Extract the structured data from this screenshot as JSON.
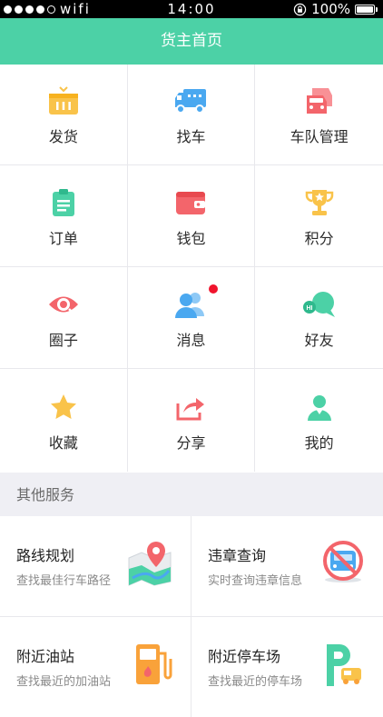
{
  "status_bar": {
    "carrier": "wifi",
    "time": "14:00",
    "battery": "100%"
  },
  "header": {
    "title": "货主首页"
  },
  "grid": {
    "rows": [
      [
        {
          "label": "发货",
          "icon": "cargo-box-icon",
          "color": "#f9c34a"
        },
        {
          "label": "找车",
          "icon": "truck-icon",
          "color": "#4aa8f0"
        },
        {
          "label": "车队管理",
          "icon": "fleet-cars-icon",
          "color": "#f3656b"
        }
      ],
      [
        {
          "label": "订单",
          "icon": "clipboard-icon",
          "color": "#4cd1a6"
        },
        {
          "label": "钱包",
          "icon": "wallet-icon",
          "color": "#f3656b"
        },
        {
          "label": "积分",
          "icon": "trophy-icon",
          "color": "#f9c34a"
        }
      ],
      [
        {
          "label": "圈子",
          "icon": "eye-circle-icon",
          "color": "#f3656b"
        },
        {
          "label": "消息",
          "icon": "users-icon",
          "color": "#4aa8f0",
          "badge": true
        },
        {
          "label": "好友",
          "icon": "chat-bubble-icon",
          "color": "#4cd1a6"
        }
      ],
      [
        {
          "label": "收藏",
          "icon": "star-icon",
          "color": "#f9c34a"
        },
        {
          "label": "分享",
          "icon": "share-arrow-icon",
          "color": "#f3656b"
        },
        {
          "label": "我的",
          "icon": "person-icon",
          "color": "#4cd1a6"
        }
      ]
    ]
  },
  "other_services": {
    "title": "其他服务",
    "items": [
      {
        "title": "路线规划",
        "subtitle": "查找最佳行车路径",
        "icon": "route-map-icon"
      },
      {
        "title": "违章查询",
        "subtitle": "实时查询违章信息",
        "icon": "no-car-icon"
      },
      {
        "title": "附近油站",
        "subtitle": "查找最近的加油站",
        "icon": "gas-pump-icon"
      },
      {
        "title": "附近停车场",
        "subtitle": "查找最近的停车场",
        "icon": "parking-icon"
      }
    ]
  },
  "colors": {
    "brand": "#4cd1a6",
    "section_bg": "#efeff4",
    "badge": "#f0142d"
  }
}
